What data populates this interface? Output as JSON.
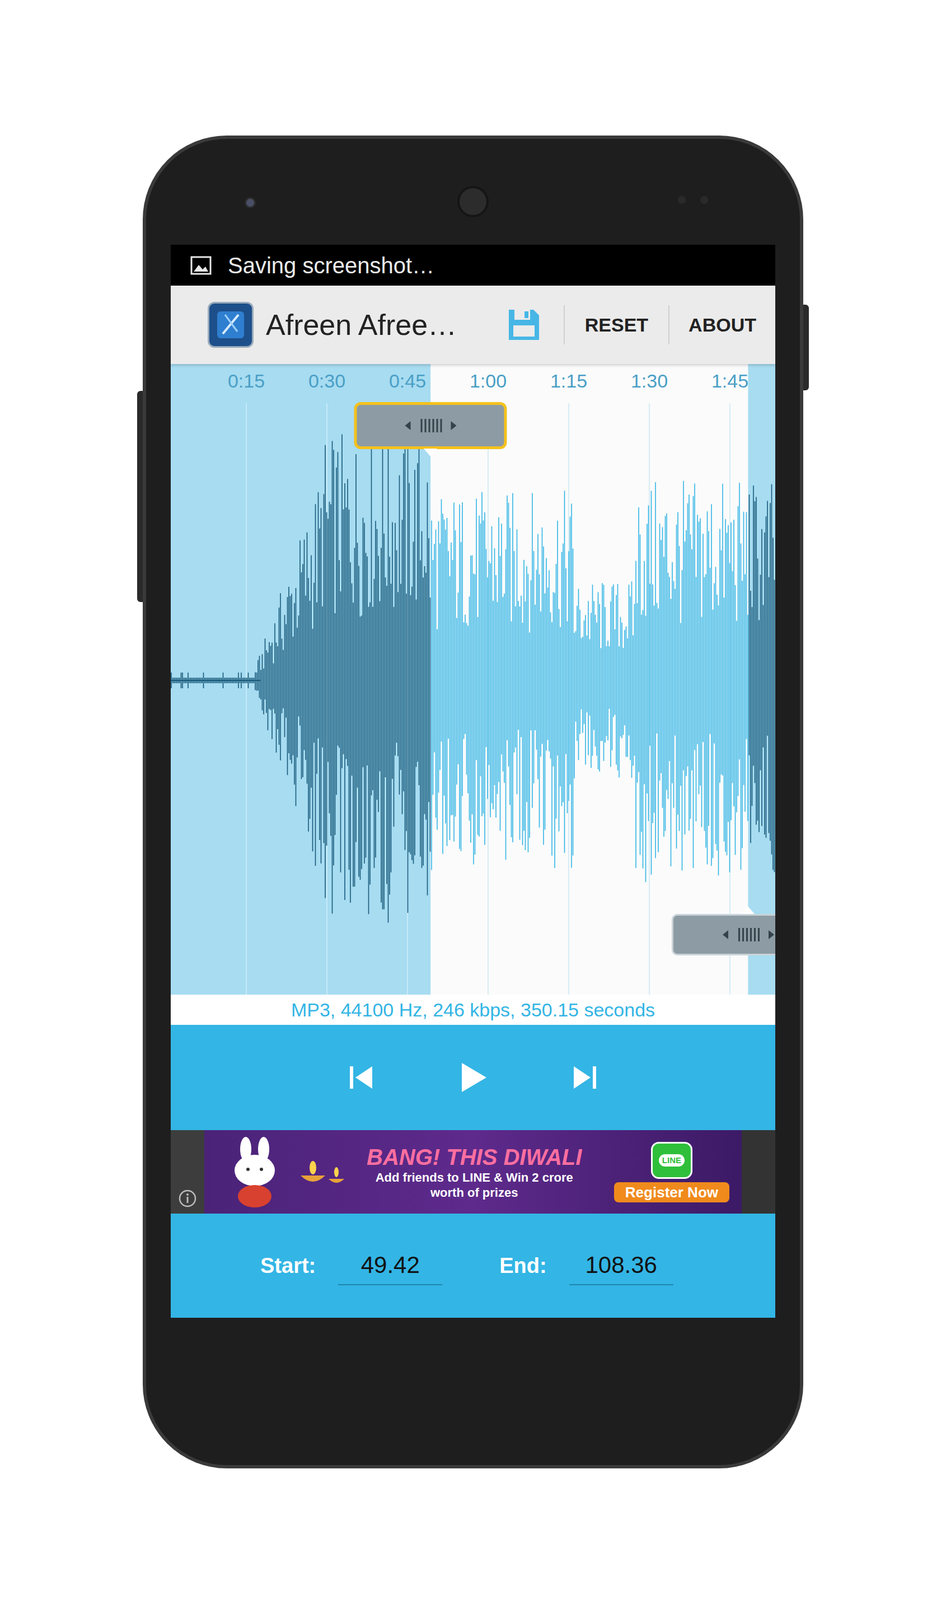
{
  "status_bar": {
    "notification": "Saving screenshot…"
  },
  "action_bar": {
    "title": "Afreen Afree…",
    "actions": [
      "RESET",
      "ABOUT"
    ]
  },
  "waveform": {
    "ticks": [
      "0:15",
      "0:30",
      "0:45",
      "1:00",
      "1:15",
      "1:30",
      "1:45"
    ],
    "selection": {
      "start_level": 0.43,
      "end_level": 0.955
    }
  },
  "file_info": "MP3, 44100 Hz, 246 kbps, 350.15 seconds",
  "player": {
    "playing": false
  },
  "ad": {
    "headline": "BANG! THIS DIWALI",
    "body": [
      "Add friends to LINE & Win 2 crore",
      "worth of prizes"
    ],
    "button": "Register Now",
    "logo": "LINE"
  },
  "range": {
    "start_label": "Start:",
    "start": "49.42",
    "end_label": "End:",
    "end": "108.36"
  }
}
